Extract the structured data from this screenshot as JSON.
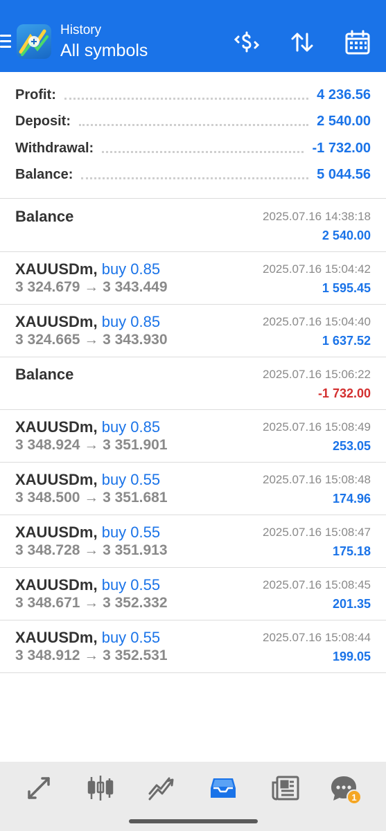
{
  "header": {
    "title": "History",
    "subtitle": "All symbols"
  },
  "summary": [
    {
      "label": "Profit:",
      "value": "4 236.56"
    },
    {
      "label": "Deposit:",
      "value": "2 540.00"
    },
    {
      "label": "Withdrawal:",
      "value": "-1 732.00"
    },
    {
      "label": "Balance:",
      "value": "5 044.56"
    }
  ],
  "rows": [
    {
      "title": "Balance",
      "action": "",
      "prices": "",
      "date": "2025.07.16 14:38:18",
      "amount": "2 540.00"
    },
    {
      "title": "XAUUSDm,",
      "action": "buy 0.85",
      "prices": "3 324.679 → 3 343.449",
      "date": "2025.07.16 15:04:42",
      "amount": "1 595.45"
    },
    {
      "title": "XAUUSDm,",
      "action": "buy 0.85",
      "prices": "3 324.665 → 3 343.930",
      "date": "2025.07.16 15:04:40",
      "amount": "1 637.52"
    },
    {
      "title": "Balance",
      "action": "",
      "prices": "",
      "date": "2025.07.16 15:06:22",
      "amount": "-1 732.00"
    },
    {
      "title": "XAUUSDm,",
      "action": "buy 0.85",
      "prices": "3 348.924 → 3 351.901",
      "date": "2025.07.16 15:08:49",
      "amount": "253.05"
    },
    {
      "title": "XAUUSDm,",
      "action": "buy 0.55",
      "prices": "3 348.500 → 3 351.681",
      "date": "2025.07.16 15:08:48",
      "amount": "174.96"
    },
    {
      "title": "XAUUSDm,",
      "action": "buy 0.55",
      "prices": "3 348.728 → 3 351.913",
      "date": "2025.07.16 15:08:47",
      "amount": "175.18"
    },
    {
      "title": "XAUUSDm,",
      "action": "buy 0.55",
      "prices": "3 348.671 → 3 352.332",
      "date": "2025.07.16 15:08:45",
      "amount": "201.35"
    },
    {
      "title": "XAUUSDm,",
      "action": "buy 0.55",
      "prices": "3 348.912 → 3 352.531",
      "date": "2025.07.16 15:08:44",
      "amount": "199.05"
    }
  ],
  "bottom_nav": {
    "items": [
      {
        "icon": "quotes-icon"
      },
      {
        "icon": "chart-icon"
      },
      {
        "icon": "trade-icon"
      },
      {
        "icon": "history-icon",
        "active": true
      },
      {
        "icon": "news-icon"
      },
      {
        "icon": "messages-icon",
        "badge": "1"
      }
    ]
  },
  "colors": {
    "accent": "#1a73e8",
    "negative": "#d32f2f",
    "badge": "#f5a623"
  }
}
